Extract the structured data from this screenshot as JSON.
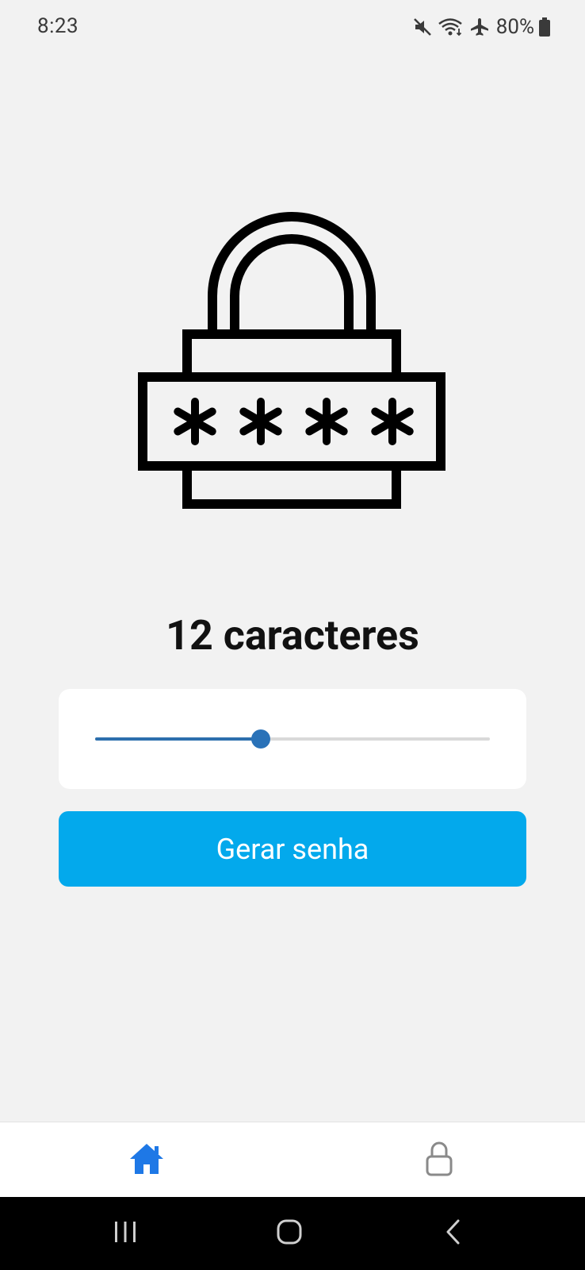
{
  "status_bar": {
    "time": "8:23",
    "battery": "80%",
    "icons": [
      "mute-icon",
      "wifi-icon",
      "airplane-icon",
      "battery-icon"
    ]
  },
  "hero": {
    "icon": "password-lock-icon"
  },
  "generator": {
    "length_label": "12 caracteres",
    "slider": {
      "value": 12,
      "fill_fraction": 0.42
    },
    "generate_label": "Gerar senha"
  },
  "tab_bar": {
    "tabs": [
      {
        "icon": "home-icon",
        "active": true
      },
      {
        "icon": "lock-icon",
        "active": false
      }
    ],
    "active_color": "#1e78e6",
    "inactive_color": "#8a8a8a"
  },
  "system_nav": {
    "buttons": [
      "recents-icon",
      "home-circle-icon",
      "back-icon"
    ]
  },
  "colors": {
    "background": "#f2f2f2",
    "button": "#03a9ec",
    "slider_fill": "#2c6fad"
  }
}
